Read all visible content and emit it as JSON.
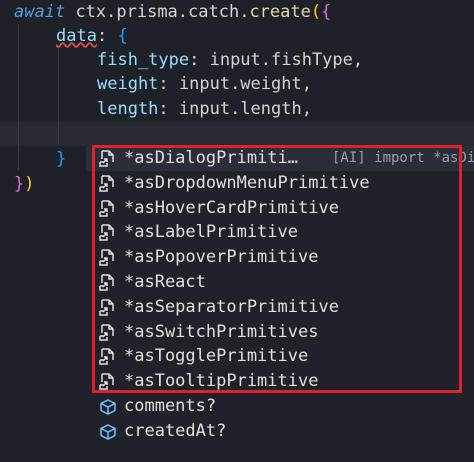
{
  "code": {
    "line1": {
      "kw": "await",
      "obj": "ctx.prisma.catch.",
      "fn": "create",
      "paren": "(",
      "brace": "{"
    },
    "line2": {
      "prop": "data",
      "colon": ":",
      "brace": "{"
    },
    "line3": {
      "prop": "fish_type",
      "rest": ": input.fishType,"
    },
    "line4": {
      "prop": "weight",
      "rest": ": input.weight,"
    },
    "line5": {
      "prop": "length",
      "rest": ": input.length,"
    },
    "line7": {
      "brace": "}"
    },
    "line8": {
      "brace": "}",
      "paren": ")"
    }
  },
  "suggestions": {
    "items": [
      {
        "label": "*asDialogPrimiti…",
        "detail": "[AI] import *asDi",
        "icon": "file-link-icon"
      },
      {
        "label": "*asDropdownMenuPrimitive",
        "icon": "file-link-icon"
      },
      {
        "label": "*asHoverCardPrimitive",
        "icon": "file-link-icon"
      },
      {
        "label": "*asLabelPrimitive",
        "icon": "file-link-icon"
      },
      {
        "label": "*asPopoverPrimitive",
        "icon": "file-link-icon"
      },
      {
        "label": "*asReact",
        "icon": "file-link-icon"
      },
      {
        "label": "*asSeparatorPrimitive",
        "icon": "file-link-icon"
      },
      {
        "label": "*asSwitchPrimitives",
        "icon": "file-link-icon"
      },
      {
        "label": "*asTogglePrimitive",
        "icon": "file-link-icon"
      },
      {
        "label": "*asTooltipPrimitive",
        "icon": "file-link-icon"
      },
      {
        "label": "comments?",
        "icon": "cube-icon"
      },
      {
        "label": "createdAt?",
        "icon": "cube-icon"
      }
    ]
  },
  "colors": {
    "highlight": "#e0212b",
    "cube_icon": "#75beff",
    "file_icon": "#e0e0e0"
  }
}
